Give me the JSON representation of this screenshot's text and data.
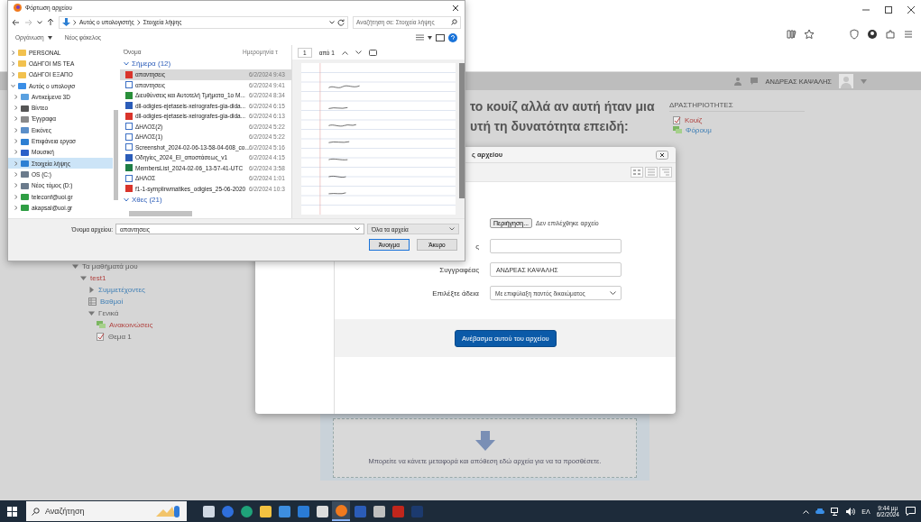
{
  "browser": {
    "user_name": "ΑΝΔΡΕΑΣ ΚΑΨΑΛΗΣ"
  },
  "page": {
    "heading_lines": [
      "το κουίζ αλλά αν αυτή ήταν μια",
      "υτή τη δυνατότητα επειδή:"
    ],
    "nav": [
      {
        "label": "Τα μαθήματά μου",
        "kind": "branch",
        "expanded": true,
        "active": false,
        "link": false,
        "children": [
          {
            "label": "test1",
            "kind": "branch",
            "expanded": true,
            "active": true,
            "link": false,
            "children": [
              {
                "label": "Συμμετέχοντες",
                "kind": "branch",
                "expanded": false,
                "active": false,
                "link": true
              },
              {
                "label": "Βαθμοί",
                "kind": "grades",
                "active": false,
                "link": true
              },
              {
                "label": "Γενικά",
                "kind": "branch",
                "expanded": true,
                "active": false,
                "link": false,
                "children": [
                  {
                    "label": "Ανακοινώσεις",
                    "kind": "forum",
                    "active": true,
                    "link": false
                  },
                  {
                    "label": "Θεμα 1",
                    "kind": "quiz",
                    "active": false,
                    "link": false
                  }
                ]
              }
            ]
          }
        ]
      }
    ],
    "activities": {
      "title": "ΔΡΑΣΤΗΡΙΟΤΗΤΕΣ",
      "items": [
        {
          "label": "Κουίζ",
          "kind": "quiz",
          "active": true,
          "link": false
        },
        {
          "label": "Φόρουμ",
          "kind": "forum",
          "active": false,
          "link": true
        }
      ]
    },
    "drop_zone": {
      "hint": "Μπορείτε να κάνετε μεταφορά και απόθεση εδώ αρχεία για να τα προσθέσετε."
    }
  },
  "file_picker_modal": {
    "title": "ς αρχείου",
    "browse_button": "Περιήγηση...",
    "no_file": "Δεν επιλέχθηκε αρχείο",
    "fields": [
      {
        "label": "ς",
        "kind": "input"
      },
      {
        "label": "Συγγραφέας",
        "kind": "input",
        "value": "ΑΝΔΡΕΑΣ ΚΑΨΑΛΗΣ"
      },
      {
        "label": "Επιλέξτε άδεια",
        "kind": "select",
        "value": "Με επιφύλαξη παντός δικαιώματος"
      }
    ],
    "upload_button": "Ανέβασμα αυτού του αρχείου"
  },
  "open_dialog": {
    "title": "Φόρτωση αρχείου",
    "path": [
      "Αυτός ο υπολογιστής",
      "Στοιχεία λήψης"
    ],
    "search": {
      "placeholder": "Αναζήτηση σε: Στοιχεία λήψης"
    },
    "organize": "Οργάνωση",
    "new_folder": "Νέος φάκελος",
    "nav": [
      {
        "label": "PERSONAL",
        "kind": "folder",
        "selected": false,
        "expanded": false
      },
      {
        "label": "ΟΔΗΓΟΙ MS TEA",
        "kind": "folder",
        "selected": false,
        "expanded": false
      },
      {
        "label": "ΟΔΗΓΟΙ ΕΞΑΠΟ",
        "kind": "folder",
        "selected": false,
        "expanded": false
      },
      {
        "label": "Αυτός ο υπολογισ",
        "kind": "pc",
        "selected": false,
        "expanded": true,
        "children": [
          {
            "label": "Αντικείμενα 3D",
            "kind": "cube",
            "selected": false,
            "expanded": false
          },
          {
            "label": "Βίντεο",
            "kind": "video",
            "selected": false,
            "expanded": false
          },
          {
            "label": "Έγγραφα",
            "kind": "docs",
            "selected": false,
            "expanded": false
          },
          {
            "label": "Εικόνες",
            "kind": "pictures",
            "selected": false,
            "expanded": false
          },
          {
            "label": "Επιφάνεια εργασ",
            "kind": "desktop",
            "selected": false,
            "expanded": false
          },
          {
            "label": "Μουσική",
            "kind": "music",
            "selected": false,
            "expanded": false
          },
          {
            "label": "Στοιχεία λήψης",
            "kind": "download",
            "selected": true,
            "expanded": false
          },
          {
            "label": "OS (C:)",
            "kind": "drive",
            "selected": false,
            "expanded": false
          },
          {
            "label": "Νέος τόμος (D:)",
            "kind": "drive",
            "selected": false,
            "expanded": false
          },
          {
            "label": "teleconf@uoi.gr",
            "kind": "cloud",
            "selected": false,
            "expanded": false
          },
          {
            "label": "akapsal@uoi.gr",
            "kind": "cloud",
            "selected": false,
            "expanded": false
          }
        ]
      }
    ],
    "columns": [
      "Όνομα",
      "Ημερομηνία τ"
    ],
    "groups": [
      {
        "label": "Σήμερα (12)",
        "expanded": true,
        "files": [
          {
            "name": "απαντησεις",
            "date": "6/2/2024 9:43",
            "kind": "pdf",
            "selected": true
          },
          {
            "name": "απαντησεις",
            "date": "6/2/2024 9:41",
            "kind": "file",
            "selected": false
          },
          {
            "name": "Διευθύνσεις και Αυτοτελή Τμήματα_1ο Μ...",
            "date": "6/2/2024 8:34",
            "kind": "app",
            "selected": false
          },
          {
            "name": "dll-odigies-ejetaseis-xeirografes-gia-dida...",
            "date": "6/2/2024 6:15",
            "kind": "word",
            "selected": false
          },
          {
            "name": "dll-odigies-ejetaseis-xeirografes-gia-dida...",
            "date": "6/2/2024 6:13",
            "kind": "pdf",
            "selected": false
          },
          {
            "name": "ΔΗΛΟΣ(2)",
            "date": "6/2/2024 5:22",
            "kind": "file",
            "selected": false
          },
          {
            "name": "ΔΗΛΟΣ(1)",
            "date": "6/2/2024 5:22",
            "kind": "file",
            "selected": false
          },
          {
            "name": "Screenshot_2024-02-06-13-58-04-608_co...",
            "date": "6/2/2024 5:16",
            "kind": "file",
            "selected": false
          },
          {
            "name": "Οδηγίες_2024_ΕΙ_αποστάσεως_v1",
            "date": "6/2/2024 4:15",
            "kind": "word",
            "selected": false
          },
          {
            "name": "MembersList_2024-02-06_13-57-41-UTC",
            "date": "6/2/2024 3:58",
            "kind": "excel",
            "selected": false
          },
          {
            "name": "ΔΗΛΟΣ",
            "date": "6/2/2024 1:01",
            "kind": "file",
            "selected": false
          },
          {
            "name": "f1-1-symplirwmatikes_odigies_25-06-2020",
            "date": "6/2/2024 10:3",
            "kind": "pdf",
            "selected": false
          }
        ]
      },
      {
        "label": "Χθες (21)",
        "expanded": true
      }
    ],
    "preview": {
      "page": "1",
      "of": "από 1"
    },
    "filename_label": "Όνομα αρχείου:",
    "filename": "απαντησεις",
    "filter": "Όλα τα αρχεία",
    "buttons": [
      {
        "label": "Άνοιγμα",
        "kind": "primary"
      },
      {
        "label": "Άκυρο",
        "kind": "normal"
      }
    ]
  },
  "taskbar": {
    "search": {
      "placeholder": "Αναζήτηση"
    },
    "apps": [
      {
        "kind": "task-view",
        "selected": false
      },
      {
        "kind": "circle",
        "selected": false
      },
      {
        "kind": "edge",
        "selected": false
      },
      {
        "kind": "folder",
        "selected": false
      },
      {
        "kind": "store",
        "selected": false
      },
      {
        "kind": "mail",
        "selected": false
      },
      {
        "kind": "gallery",
        "selected": false
      },
      {
        "kind": "firefox",
        "selected": true
      },
      {
        "kind": "word",
        "selected": false
      },
      {
        "kind": "palette",
        "selected": false
      },
      {
        "kind": "pdf",
        "selected": false
      },
      {
        "kind": "ps",
        "selected": false
      }
    ],
    "language": "ΕΛ",
    "time": "9:44 μμ",
    "date": "6/2/2024"
  }
}
